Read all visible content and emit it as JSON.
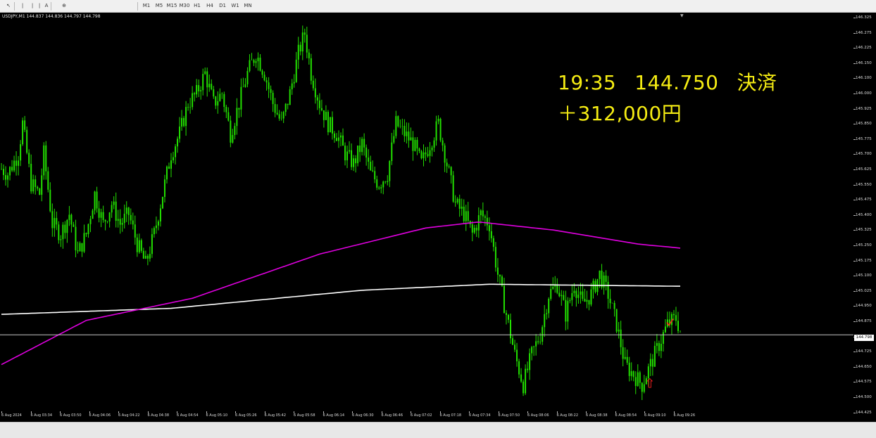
{
  "toolbar": {
    "buttons": [
      "↖",
      "|",
      "|",
      "|",
      "A",
      "⊕",
      "M1",
      "M5",
      "M15",
      "M30",
      "H1",
      "H4",
      "D1",
      "W1",
      "MN"
    ]
  },
  "symbol_label": "USDJPY,M1  144.837 144.836 144.797 144.798",
  "note": {
    "time": "19:35",
    "price": "144.750",
    "action": "決済",
    "profit": "＋312,000円"
  },
  "colors": {
    "background": "#000000",
    "candles": "#22e000",
    "ma_long": "#ffffff",
    "ma_mid": "#e000e0",
    "note_text": "#f5ec13",
    "arrow": "#ff2020"
  },
  "chart_data": {
    "type": "line",
    "symbol": "USDJPY",
    "timeframe": "M1",
    "current_price": "144.798",
    "price_ticks": [
      "146.325",
      "146.275",
      "146.225",
      "146.150",
      "146.100",
      "146.000",
      "145.925",
      "145.850",
      "145.775",
      "145.700",
      "145.625",
      "145.550",
      "145.475",
      "145.400",
      "145.325",
      "145.250",
      "145.175",
      "145.100",
      "145.025",
      "144.950",
      "144.875",
      "144.798",
      "144.725",
      "144.650",
      "144.575",
      "144.500",
      "144.425"
    ],
    "time_labels": [
      "6 Aug 2024",
      "6 Aug 03:34",
      "6 Aug 03:50",
      "6 Aug 04:06",
      "6 Aug 04:22",
      "6 Aug 04:38",
      "6 Aug 04:54",
      "6 Aug 05:10",
      "6 Aug 05:26",
      "6 Aug 05:42",
      "6 Aug 05:58",
      "6 Aug 06:14",
      "6 Aug 06:30",
      "6 Aug 06:46",
      "6 Aug 07:02",
      "6 Aug 07:18",
      "6 Aug 07:34",
      "6 Aug 07:50",
      "6 Aug 08:06",
      "6 Aug 08:22",
      "6 Aug 08:38",
      "6 Aug 08:54",
      "6 Aug 09:10",
      "6 Aug 09:26"
    ],
    "price_keypoints": [
      [
        0,
        145.625
      ],
      [
        3,
        145.6
      ],
      [
        8,
        145.7
      ],
      [
        10,
        145.85
      ],
      [
        14,
        145.55
      ],
      [
        18,
        145.5
      ],
      [
        20,
        145.7
      ],
      [
        24,
        145.35
      ],
      [
        28,
        145.3
      ],
      [
        32,
        145.4
      ],
      [
        36,
        145.2
      ],
      [
        40,
        145.3
      ],
      [
        44,
        145.5
      ],
      [
        48,
        145.35
      ],
      [
        52,
        145.45
      ],
      [
        56,
        145.35
      ],
      [
        60,
        145.4
      ],
      [
        64,
        145.25
      ],
      [
        68,
        145.15
      ],
      [
        72,
        145.3
      ],
      [
        76,
        145.5
      ],
      [
        80,
        145.7
      ],
      [
        84,
        145.8
      ],
      [
        88,
        145.95
      ],
      [
        92,
        146.0
      ],
      [
        96,
        146.1
      ],
      [
        100,
        145.95
      ],
      [
        104,
        146.0
      ],
      [
        108,
        145.8
      ],
      [
        112,
        145.95
      ],
      [
        116,
        146.1
      ],
      [
        120,
        146.2
      ],
      [
        124,
        146.1
      ],
      [
        128,
        145.95
      ],
      [
        132,
        145.85
      ],
      [
        136,
        146.0
      ],
      [
        140,
        146.2
      ],
      [
        143,
        146.3
      ],
      [
        146,
        146.1
      ],
      [
        150,
        145.95
      ],
      [
        154,
        145.85
      ],
      [
        158,
        145.8
      ],
      [
        162,
        145.7
      ],
      [
        166,
        145.65
      ],
      [
        170,
        145.75
      ],
      [
        174,
        145.6
      ],
      [
        178,
        145.55
      ],
      [
        182,
        145.6
      ],
      [
        186,
        145.85
      ],
      [
        190,
        145.8
      ],
      [
        194,
        145.75
      ],
      [
        198,
        145.65
      ],
      [
        202,
        145.75
      ],
      [
        206,
        145.85
      ],
      [
        210,
        145.65
      ],
      [
        214,
        145.45
      ],
      [
        218,
        145.4
      ],
      [
        222,
        145.3
      ],
      [
        226,
        145.4
      ],
      [
        230,
        145.35
      ],
      [
        234,
        145.1
      ],
      [
        238,
        144.9
      ],
      [
        242,
        144.7
      ],
      [
        246,
        144.55
      ],
      [
        250,
        144.7
      ],
      [
        254,
        144.8
      ],
      [
        258,
        145.0
      ],
      [
        262,
        145.05
      ],
      [
        266,
        144.9
      ],
      [
        270,
        145.05
      ],
      [
        274,
        144.95
      ],
      [
        278,
        145.0
      ],
      [
        282,
        145.1
      ],
      [
        286,
        145.0
      ],
      [
        290,
        144.85
      ],
      [
        294,
        144.65
      ],
      [
        298,
        144.6
      ],
      [
        302,
        144.55
      ],
      [
        306,
        144.65
      ],
      [
        310,
        144.75
      ],
      [
        314,
        144.85
      ],
      [
        318,
        144.88
      ],
      [
        320,
        144.82
      ]
    ],
    "ma_mid_keypoints": [
      [
        0,
        144.65
      ],
      [
        40,
        144.87
      ],
      [
        90,
        144.98
      ],
      [
        150,
        145.2
      ],
      [
        200,
        145.33
      ],
      [
        225,
        145.36
      ],
      [
        260,
        145.32
      ],
      [
        300,
        145.25
      ],
      [
        320,
        145.23
      ]
    ],
    "ma_long_keypoints": [
      [
        0,
        144.9
      ],
      [
        80,
        144.93
      ],
      [
        130,
        144.98
      ],
      [
        170,
        145.02
      ],
      [
        230,
        145.05
      ],
      [
        320,
        145.04
      ]
    ],
    "annotations": {
      "exit_arrow_index": 315,
      "entry_arrow_index": 305,
      "entry_arrow_symbol": "⇧"
    }
  }
}
